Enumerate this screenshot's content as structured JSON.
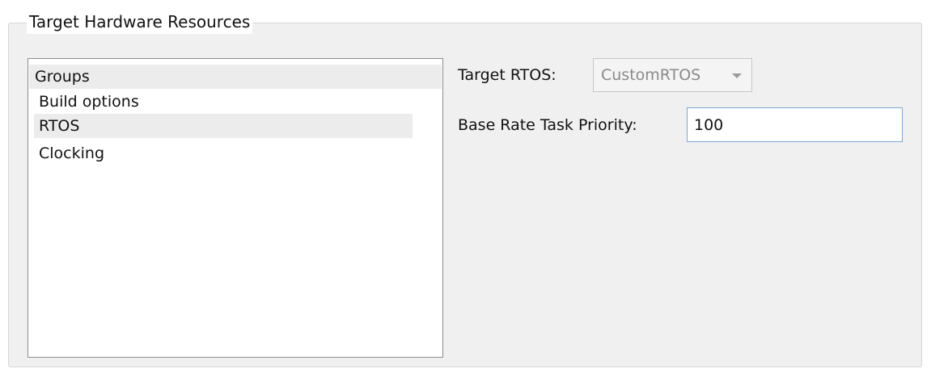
{
  "panel": {
    "title": "Target Hardware Resources"
  },
  "groups": {
    "header": "Groups",
    "items": [
      {
        "label": "Build options",
        "selected": false
      },
      {
        "label": "RTOS",
        "selected": true
      },
      {
        "label": "Clocking",
        "selected": false
      }
    ]
  },
  "settings": {
    "rtos_label": "Target RTOS:",
    "rtos_value": "CustomRTOS",
    "rtos_enabled": false,
    "priority_label": "Base Rate Task Priority:",
    "priority_value": "100"
  },
  "colors": {
    "panel_bg": "#f0f0f0",
    "selected_row": "#ececec",
    "input_focus_border": "#7aa7d6",
    "disabled_text": "#8a8a8a"
  }
}
